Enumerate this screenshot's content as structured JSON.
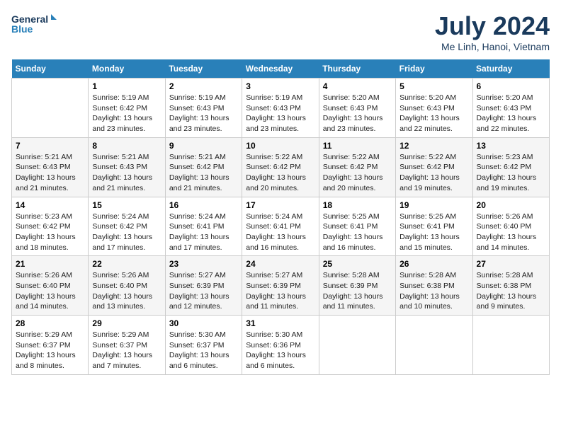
{
  "logo": {
    "text_general": "General",
    "text_blue": "Blue"
  },
  "title": "July 2024",
  "subtitle": "Me Linh, Hanoi, Vietnam",
  "days_of_week": [
    "Sunday",
    "Monday",
    "Tuesday",
    "Wednesday",
    "Thursday",
    "Friday",
    "Saturday"
  ],
  "weeks": [
    [
      {
        "day": "",
        "content": ""
      },
      {
        "day": "1",
        "content": "Sunrise: 5:19 AM\nSunset: 6:42 PM\nDaylight: 13 hours\nand 23 minutes."
      },
      {
        "day": "2",
        "content": "Sunrise: 5:19 AM\nSunset: 6:43 PM\nDaylight: 13 hours\nand 23 minutes."
      },
      {
        "day": "3",
        "content": "Sunrise: 5:19 AM\nSunset: 6:43 PM\nDaylight: 13 hours\nand 23 minutes."
      },
      {
        "day": "4",
        "content": "Sunrise: 5:20 AM\nSunset: 6:43 PM\nDaylight: 13 hours\nand 23 minutes."
      },
      {
        "day": "5",
        "content": "Sunrise: 5:20 AM\nSunset: 6:43 PM\nDaylight: 13 hours\nand 22 minutes."
      },
      {
        "day": "6",
        "content": "Sunrise: 5:20 AM\nSunset: 6:43 PM\nDaylight: 13 hours\nand 22 minutes."
      }
    ],
    [
      {
        "day": "7",
        "content": "Sunrise: 5:21 AM\nSunset: 6:43 PM\nDaylight: 13 hours\nand 21 minutes."
      },
      {
        "day": "8",
        "content": "Sunrise: 5:21 AM\nSunset: 6:43 PM\nDaylight: 13 hours\nand 21 minutes."
      },
      {
        "day": "9",
        "content": "Sunrise: 5:21 AM\nSunset: 6:42 PM\nDaylight: 13 hours\nand 21 minutes."
      },
      {
        "day": "10",
        "content": "Sunrise: 5:22 AM\nSunset: 6:42 PM\nDaylight: 13 hours\nand 20 minutes."
      },
      {
        "day": "11",
        "content": "Sunrise: 5:22 AM\nSunset: 6:42 PM\nDaylight: 13 hours\nand 20 minutes."
      },
      {
        "day": "12",
        "content": "Sunrise: 5:22 AM\nSunset: 6:42 PM\nDaylight: 13 hours\nand 19 minutes."
      },
      {
        "day": "13",
        "content": "Sunrise: 5:23 AM\nSunset: 6:42 PM\nDaylight: 13 hours\nand 19 minutes."
      }
    ],
    [
      {
        "day": "14",
        "content": "Sunrise: 5:23 AM\nSunset: 6:42 PM\nDaylight: 13 hours\nand 18 minutes."
      },
      {
        "day": "15",
        "content": "Sunrise: 5:24 AM\nSunset: 6:42 PM\nDaylight: 13 hours\nand 17 minutes."
      },
      {
        "day": "16",
        "content": "Sunrise: 5:24 AM\nSunset: 6:41 PM\nDaylight: 13 hours\nand 17 minutes."
      },
      {
        "day": "17",
        "content": "Sunrise: 5:24 AM\nSunset: 6:41 PM\nDaylight: 13 hours\nand 16 minutes."
      },
      {
        "day": "18",
        "content": "Sunrise: 5:25 AM\nSunset: 6:41 PM\nDaylight: 13 hours\nand 16 minutes."
      },
      {
        "day": "19",
        "content": "Sunrise: 5:25 AM\nSunset: 6:41 PM\nDaylight: 13 hours\nand 15 minutes."
      },
      {
        "day": "20",
        "content": "Sunrise: 5:26 AM\nSunset: 6:40 PM\nDaylight: 13 hours\nand 14 minutes."
      }
    ],
    [
      {
        "day": "21",
        "content": "Sunrise: 5:26 AM\nSunset: 6:40 PM\nDaylight: 13 hours\nand 14 minutes."
      },
      {
        "day": "22",
        "content": "Sunrise: 5:26 AM\nSunset: 6:40 PM\nDaylight: 13 hours\nand 13 minutes."
      },
      {
        "day": "23",
        "content": "Sunrise: 5:27 AM\nSunset: 6:39 PM\nDaylight: 13 hours\nand 12 minutes."
      },
      {
        "day": "24",
        "content": "Sunrise: 5:27 AM\nSunset: 6:39 PM\nDaylight: 13 hours\nand 11 minutes."
      },
      {
        "day": "25",
        "content": "Sunrise: 5:28 AM\nSunset: 6:39 PM\nDaylight: 13 hours\nand 11 minutes."
      },
      {
        "day": "26",
        "content": "Sunrise: 5:28 AM\nSunset: 6:38 PM\nDaylight: 13 hours\nand 10 minutes."
      },
      {
        "day": "27",
        "content": "Sunrise: 5:28 AM\nSunset: 6:38 PM\nDaylight: 13 hours\nand 9 minutes."
      }
    ],
    [
      {
        "day": "28",
        "content": "Sunrise: 5:29 AM\nSunset: 6:37 PM\nDaylight: 13 hours\nand 8 minutes."
      },
      {
        "day": "29",
        "content": "Sunrise: 5:29 AM\nSunset: 6:37 PM\nDaylight: 13 hours\nand 7 minutes."
      },
      {
        "day": "30",
        "content": "Sunrise: 5:30 AM\nSunset: 6:37 PM\nDaylight: 13 hours\nand 6 minutes."
      },
      {
        "day": "31",
        "content": "Sunrise: 5:30 AM\nSunset: 6:36 PM\nDaylight: 13 hours\nand 6 minutes."
      },
      {
        "day": "",
        "content": ""
      },
      {
        "day": "",
        "content": ""
      },
      {
        "day": "",
        "content": ""
      }
    ]
  ]
}
